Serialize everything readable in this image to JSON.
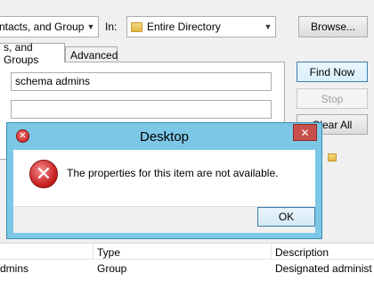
{
  "find": {
    "type_value": "ntacts, and Groups",
    "in_label": "In:",
    "location_value": "Entire Directory",
    "browse_label": "Browse..."
  },
  "tabs": [
    {
      "label": "s, and Groups"
    },
    {
      "label": "Advanced"
    }
  ],
  "form": {
    "name_value": "schema admins",
    "description_value": ""
  },
  "buttons": {
    "find_now": "Find Now",
    "stop": "Stop",
    "clear_all": "Clear All"
  },
  "results": {
    "columns": [
      "Type",
      "Description"
    ],
    "rows": [
      {
        "name": "dmins",
        "type": "Group",
        "description": "Designated administ"
      }
    ]
  },
  "dialog": {
    "title": "Desktop",
    "message": "The properties for this item are not available.",
    "ok_label": "OK",
    "close_glyph": "✕",
    "icon": "error-icon",
    "accent": "#7dc7e6"
  }
}
